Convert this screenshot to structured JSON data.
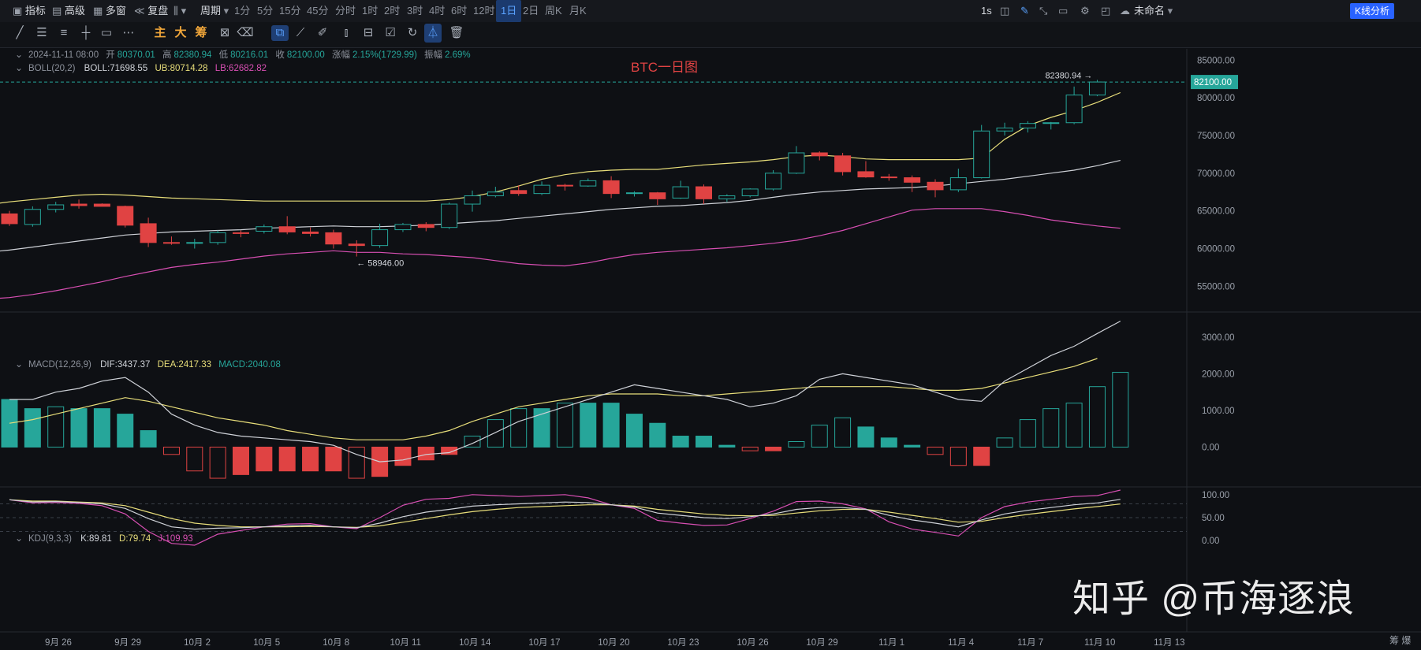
{
  "toolbar": {
    "indicators_label": "指标",
    "advanced_label": "高级",
    "multiwindow_label": "多窗",
    "replay_label": "复盘",
    "period_label": "周期",
    "timeframes": [
      "1分",
      "5分",
      "15分",
      "45分",
      "分时",
      "1时",
      "2时",
      "3时",
      "4时",
      "6时",
      "12时",
      "1日",
      "2日",
      "周K",
      "月K"
    ],
    "active_timeframe": "1日",
    "second_label": "1s",
    "unnamed_label": "未命名",
    "kline_button": "K线分析"
  },
  "drawing_tools": {
    "text_items": [
      "主",
      "大",
      "筹"
    ]
  },
  "chart": {
    "title": "BTC一日图",
    "ohlc": {
      "date": "2024-11-11 08:00",
      "open_label": "开",
      "open": "80370.01",
      "high_label": "高",
      "high": "82380.94",
      "low_label": "低",
      "low": "80216.01",
      "close_label": "收",
      "close": "82100.00",
      "change_label": "涨幅",
      "change": "2.15%(1729.99)",
      "amplitude_label": "振幅",
      "amplitude": "2.69%"
    },
    "boll": {
      "name": "BOLL(20,2)",
      "mid": "BOLL:71698.55",
      "ub": "UB:80714.28",
      "lb": "LB:62682.82"
    },
    "macd": {
      "name": "MACD(12,26,9)",
      "dif": "DIF:3437.37",
      "dea": "DEA:2417.33",
      "macd": "MACD:2040.08"
    },
    "kdj": {
      "name": "KDJ(9,3,3)",
      "k": "K:89.81",
      "d": "D:79.74",
      "j": "J:109.93"
    },
    "high_marker": "82380.94",
    "low_marker": "58946.00",
    "current_price": "82100.00",
    "price_ticks": [
      "85000.00",
      "80000.00",
      "75000.00",
      "70000.00",
      "65000.00",
      "60000.00",
      "55000.00"
    ],
    "macd_ticks": [
      "3000.00",
      "2000.00",
      "1000.00",
      "0.00"
    ],
    "kdj_ticks": [
      "100.00",
      "50.00",
      "0.00"
    ],
    "x_labels": [
      "9月 26",
      "9月 29",
      "10月 2",
      "10月 5",
      "10月 8",
      "10月 11",
      "10月 14",
      "10月 17",
      "10月 20",
      "10月 23",
      "10月 26",
      "10月 29",
      "11月 1",
      "11月 4",
      "11月 7",
      "11月 10",
      "11月 13"
    ],
    "corner_label": "筹 爆"
  },
  "watermark": "知乎 @币海逐浪",
  "colors": {
    "up": "#26a69a",
    "down": "#e04343",
    "boll_mid": "#cfd2d8",
    "boll_ub": "#e8de7a",
    "boll_lb": "#d84fb3",
    "accent": "#2962ff"
  },
  "chart_data": {
    "type": "candlestick",
    "x_label_every": 3,
    "candles": [
      {
        "o": 64000,
        "h": 64700,
        "l": 63300,
        "c": 63700
      },
      {
        "o": 64600,
        "h": 65000,
        "l": 63000,
        "c": 63300
      },
      {
        "o": 63200,
        "h": 65600,
        "l": 62900,
        "c": 65200
      },
      {
        "o": 65200,
        "h": 66200,
        "l": 64800,
        "c": 65800
      },
      {
        "o": 65900,
        "h": 66500,
        "l": 65300,
        "c": 65700
      },
      {
        "o": 65900,
        "h": 66000,
        "l": 65600,
        "c": 65600
      },
      {
        "o": 65600,
        "h": 65700,
        "l": 62800,
        "c": 63100
      },
      {
        "o": 63300,
        "h": 64100,
        "l": 60200,
        "c": 60800
      },
      {
        "o": 60800,
        "h": 61600,
        "l": 60500,
        "c": 60700
      },
      {
        "o": 60700,
        "h": 61300,
        "l": 60000,
        "c": 60800
      },
      {
        "o": 60800,
        "h": 62400,
        "l": 60500,
        "c": 62100
      },
      {
        "o": 62100,
        "h": 62400,
        "l": 61500,
        "c": 62000
      },
      {
        "o": 62300,
        "h": 63200,
        "l": 62000,
        "c": 62900
      },
      {
        "o": 62900,
        "h": 64300,
        "l": 61900,
        "c": 62200
      },
      {
        "o": 62200,
        "h": 62800,
        "l": 61600,
        "c": 62000
      },
      {
        "o": 62100,
        "h": 62500,
        "l": 60000,
        "c": 60600
      },
      {
        "o": 60600,
        "h": 61100,
        "l": 58946,
        "c": 60400
      },
      {
        "o": 60400,
        "h": 63300,
        "l": 60100,
        "c": 62500
      },
      {
        "o": 62500,
        "h": 63400,
        "l": 62200,
        "c": 63200
      },
      {
        "o": 63200,
        "h": 63500,
        "l": 62300,
        "c": 62800
      },
      {
        "o": 62800,
        "h": 66100,
        "l": 62600,
        "c": 65900
      },
      {
        "o": 65900,
        "h": 67700,
        "l": 64900,
        "c": 67000
      },
      {
        "o": 67000,
        "h": 68200,
        "l": 66800,
        "c": 67500
      },
      {
        "o": 67700,
        "h": 68400,
        "l": 67000,
        "c": 67300
      },
      {
        "o": 67300,
        "h": 68900,
        "l": 67100,
        "c": 68400
      },
      {
        "o": 68400,
        "h": 68600,
        "l": 67700,
        "c": 68300
      },
      {
        "o": 68300,
        "h": 69300,
        "l": 68200,
        "c": 69000
      },
      {
        "o": 69000,
        "h": 69600,
        "l": 66700,
        "c": 67300
      },
      {
        "o": 67300,
        "h": 67600,
        "l": 66900,
        "c": 67400
      },
      {
        "o": 67400,
        "h": 67500,
        "l": 65800,
        "c": 66600
      },
      {
        "o": 66700,
        "h": 69000,
        "l": 66600,
        "c": 68200
      },
      {
        "o": 68200,
        "h": 68500,
        "l": 65900,
        "c": 66600
      },
      {
        "o": 66600,
        "h": 67200,
        "l": 66200,
        "c": 67000
      },
      {
        "o": 67000,
        "h": 68000,
        "l": 66800,
        "c": 67900
      },
      {
        "o": 67900,
        "h": 70400,
        "l": 67700,
        "c": 70000
      },
      {
        "o": 70000,
        "h": 73600,
        "l": 69900,
        "c": 72700
      },
      {
        "o": 72700,
        "h": 72900,
        "l": 71700,
        "c": 72300
      },
      {
        "o": 72300,
        "h": 72700,
        "l": 69700,
        "c": 70200
      },
      {
        "o": 70200,
        "h": 71600,
        "l": 69400,
        "c": 69500
      },
      {
        "o": 69500,
        "h": 69900,
        "l": 69000,
        "c": 69400
      },
      {
        "o": 69400,
        "h": 69700,
        "l": 67500,
        "c": 68800
      },
      {
        "o": 68800,
        "h": 69200,
        "l": 66800,
        "c": 67800
      },
      {
        "o": 67800,
        "h": 70600,
        "l": 67500,
        "c": 69400
      },
      {
        "o": 69400,
        "h": 76400,
        "l": 69300,
        "c": 75600
      },
      {
        "o": 75600,
        "h": 76700,
        "l": 75000,
        "c": 76000
      },
      {
        "o": 76000,
        "h": 76900,
        "l": 75400,
        "c": 76600
      },
      {
        "o": 76600,
        "h": 76800,
        "l": 75800,
        "c": 76700
      },
      {
        "o": 76700,
        "h": 81500,
        "l": 76500,
        "c": 80370
      },
      {
        "o": 80370,
        "h": 82380.94,
        "l": 80216,
        "c": 82100
      }
    ],
    "boll_mid": [
      59500,
      59800,
      60200,
      60600,
      61000,
      61400,
      61800,
      62000,
      62200,
      62300,
      62400,
      62500,
      62700,
      62800,
      62900,
      63000,
      62900,
      62900,
      63000,
      63100,
      63300,
      63500,
      63700,
      64000,
      64300,
      64600,
      64900,
      65200,
      65400,
      65600,
      65700,
      65900,
      66100,
      66400,
      66800,
      67200,
      67500,
      67700,
      67900,
      68000,
      68100,
      68300,
      68600,
      68900,
      69200,
      69600,
      70000,
      70400,
      71000,
      71700
    ],
    "boll_ub": [
      65800,
      66200,
      66500,
      66800,
      67100,
      67200,
      67100,
      66900,
      66700,
      66600,
      66500,
      66400,
      66300,
      66300,
      66300,
      66300,
      66300,
      66300,
      66300,
      66300,
      66500,
      66900,
      67500,
      68300,
      69200,
      69800,
      70200,
      70400,
      70500,
      70500,
      70800,
      71100,
      71300,
      71500,
      71800,
      72200,
      72400,
      72200,
      71900,
      71800,
      71800,
      71800,
      71800,
      72000,
      74500,
      76300,
      77400,
      78300,
      79400,
      80700
    ],
    "boll_lb": [
      53300,
      53500,
      53900,
      54400,
      55000,
      55600,
      56300,
      56900,
      57500,
      57900,
      58200,
      58600,
      59000,
      59300,
      59500,
      59700,
      59500,
      59500,
      59300,
      59200,
      59000,
      58800,
      58400,
      58000,
      57800,
      57700,
      58100,
      58700,
      59200,
      59500,
      59700,
      59900,
      60100,
      60400,
      60700,
      61100,
      61700,
      62400,
      63300,
      64200,
      65100,
      65300,
      65300,
      65300,
      64900,
      64400,
      63800,
      63400,
      63000,
      62700
    ],
    "macd_dif": [
      1300,
      1300,
      1500,
      1600,
      1800,
      1900,
      1500,
      900,
      600,
      400,
      300,
      250,
      200,
      150,
      50,
      -200,
      -400,
      -350,
      -200,
      -150,
      100,
      400,
      700,
      900,
      1100,
      1300,
      1500,
      1700,
      1600,
      1500,
      1400,
      1300,
      1100,
      1200,
      1400,
      1850,
      2000,
      1900,
      1800,
      1700,
      1500,
      1300,
      1250,
      1800,
      2150,
      2500,
      2750,
      3100,
      3437.37
    ],
    "macd_dea": [
      650,
      750,
      900,
      1050,
      1200,
      1350,
      1250,
      1100,
      950,
      800,
      700,
      600,
      450,
      350,
      250,
      200,
      200,
      200,
      300,
      450,
      700,
      900,
      1100,
      1200,
      1300,
      1400,
      1450,
      1450,
      1450,
      1400,
      1400,
      1450,
      1500,
      1550,
      1600,
      1650,
      1650,
      1650,
      1650,
      1600,
      1550,
      1550,
      1600,
      1750,
      1900,
      2050,
      2200,
      2417.33
    ],
    "macd_hist": [
      1300,
      1050,
      1100,
      1050,
      1050,
      900,
      450,
      -200,
      -650,
      -850,
      -750,
      -650,
      -650,
      -650,
      -650,
      -850,
      -800,
      -500,
      -350,
      -200,
      300,
      750,
      1050,
      1050,
      1200,
      1200,
      1200,
      900,
      650,
      300,
      300,
      50,
      -100,
      -100,
      150,
      600,
      800,
      550,
      250,
      50,
      -200,
      -500,
      -500,
      250,
      750,
      1050,
      1200,
      1650,
      2040.08
    ],
    "k": [
      89,
      84,
      85,
      83,
      80,
      70,
      48,
      30,
      25,
      27,
      28,
      30,
      32,
      33,
      30,
      28,
      38,
      52,
      62,
      68,
      75,
      78,
      80,
      82,
      84,
      83,
      78,
      73,
      60,
      55,
      50,
      48,
      52,
      58,
      68,
      72,
      72,
      68,
      55,
      45,
      38,
      30,
      45,
      58,
      66,
      72,
      78,
      82,
      89.81
    ],
    "d": [
      89,
      86,
      86,
      84,
      82,
      76,
      62,
      48,
      38,
      33,
      30,
      30,
      30,
      31,
      30,
      29,
      32,
      40,
      48,
      56,
      63,
      68,
      72,
      74,
      76,
      78,
      78,
      75,
      68,
      63,
      58,
      55,
      54,
      55,
      60,
      65,
      68,
      68,
      62,
      55,
      48,
      40,
      42,
      50,
      57,
      63,
      69,
      74,
      79.74
    ],
    "j": [
      89,
      82,
      83,
      81,
      76,
      58,
      20,
      -6,
      -10,
      14,
      22,
      30,
      36,
      37,
      30,
      26,
      50,
      77,
      90,
      92,
      100,
      98,
      96,
      98,
      100,
      93,
      78,
      70,
      44,
      38,
      33,
      34,
      48,
      64,
      85,
      86,
      80,
      69,
      41,
      25,
      18,
      10,
      50,
      74,
      84,
      90,
      96,
      98,
      109.93
    ],
    "price_range": [
      52000,
      86500
    ],
    "macd_range": [
      -1000,
      3600
    ],
    "kdj_range": [
      -10,
      110
    ]
  }
}
